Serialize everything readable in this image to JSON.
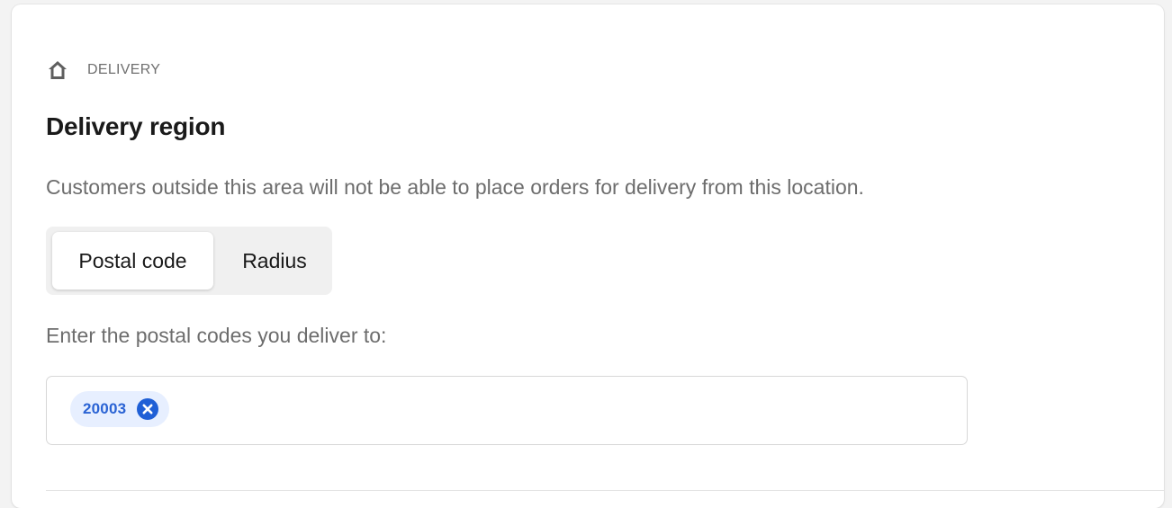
{
  "breadcrumb": {
    "icon": "home-icon",
    "label": "DELIVERY"
  },
  "section": {
    "title": "Delivery region",
    "description": "Customers outside this area will not be able to place orders for delivery from this location."
  },
  "mode_toggle": {
    "options": [
      {
        "label": "Postal code",
        "selected": true
      },
      {
        "label": "Radius",
        "selected": false
      }
    ]
  },
  "postal_codes": {
    "prompt": "Enter the postal codes you deliver to:",
    "tags": [
      {
        "value": "20003",
        "remove_icon": "close-circle-icon"
      }
    ]
  },
  "colors": {
    "chip_background": "#e7efff",
    "chip_text": "#2a63d4",
    "remove_icon": "#1f5fd6"
  }
}
